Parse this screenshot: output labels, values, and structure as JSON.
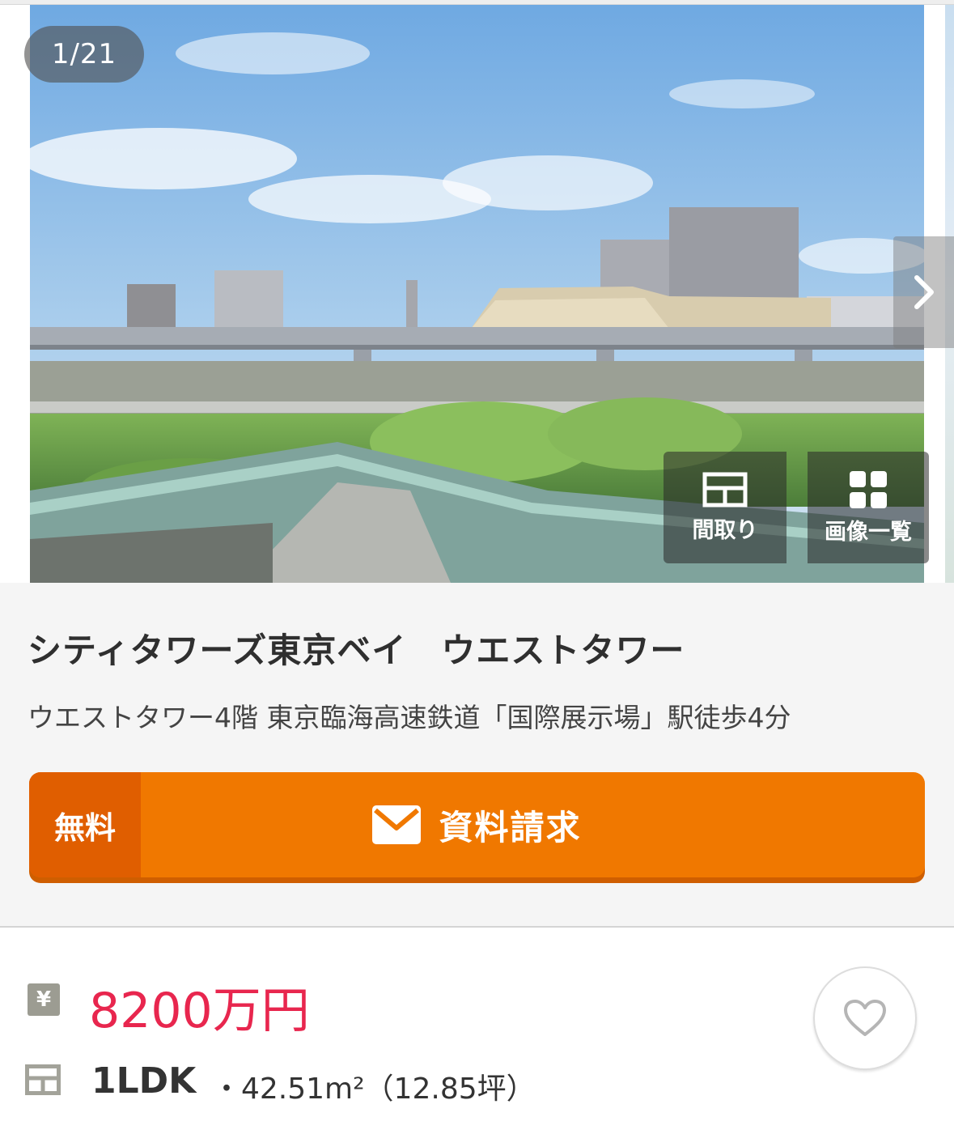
{
  "gallery": {
    "counter": "1/21",
    "floorplan_label": "間取り",
    "all_images_label": "画像一覧",
    "next_icon": "chevron-right-icon"
  },
  "property": {
    "title": "シティタワーズ東京ベイ　ウエストタワー",
    "subtitle": "ウエストタワー4階 東京臨海高速鉄道「国際展示場」駅徒歩4分"
  },
  "cta": {
    "free_label": "無料",
    "request_label": "資料請求",
    "icon": "mail-icon"
  },
  "details": {
    "yen_icon_text": "¥",
    "price": "8200万円",
    "layout": "1LDK",
    "area": "・42.51m²（12.85坪）"
  },
  "colors": {
    "cta_orange": "#f07800",
    "cta_dark_orange": "#e05e00",
    "price_red": "#e8264e"
  }
}
